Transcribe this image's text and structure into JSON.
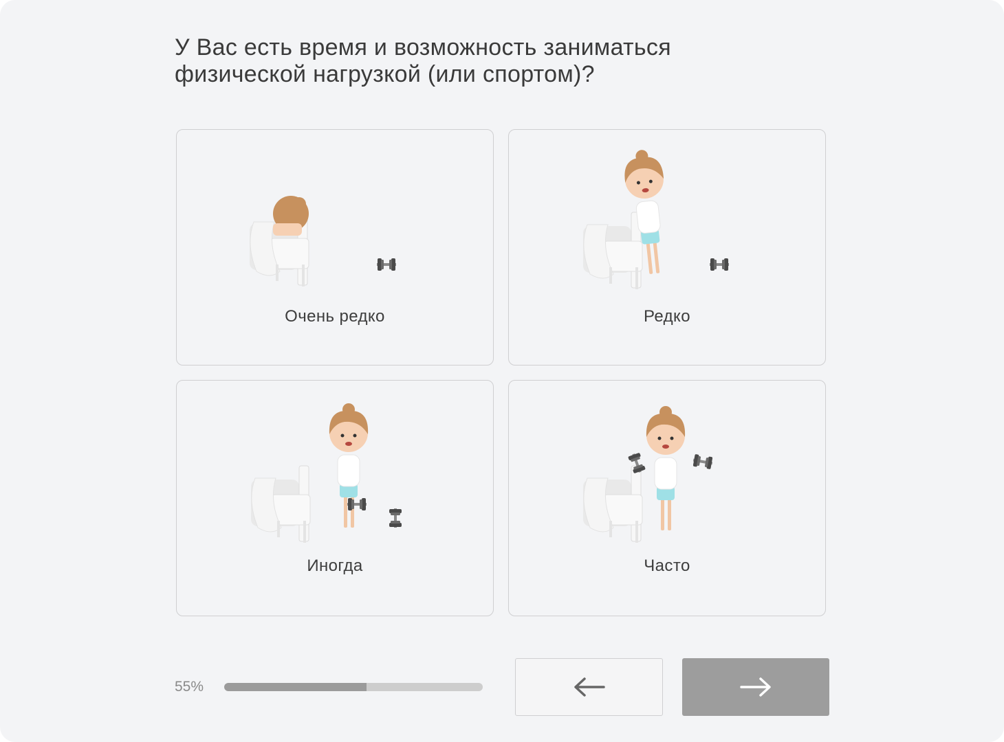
{
  "question": {
    "line1": "У Вас есть время и возможность заниматься",
    "line2": "физической нагрузкой (или спортом)?"
  },
  "options": [
    {
      "label": "Очень редко",
      "illustration": "sleeping-in-bed"
    },
    {
      "label": "Редко",
      "illustration": "leaning-on-bed"
    },
    {
      "label": "Иногда",
      "illustration": "lifting-one-dumbbell"
    },
    {
      "label": "Часто",
      "illustration": "lifting-two-dumbbells"
    }
  ],
  "progress": {
    "text": "55%",
    "value": 0.55
  },
  "navigation": {
    "back_icon": "arrow-left-icon",
    "next_icon": "arrow-right-icon"
  },
  "colors": {
    "background": "#f3f4f6",
    "card_border": "#cfcfd1",
    "progress_fill": "#9b9b9b",
    "progress_track": "#cdcdcd",
    "next_button": "#9d9d9d"
  }
}
